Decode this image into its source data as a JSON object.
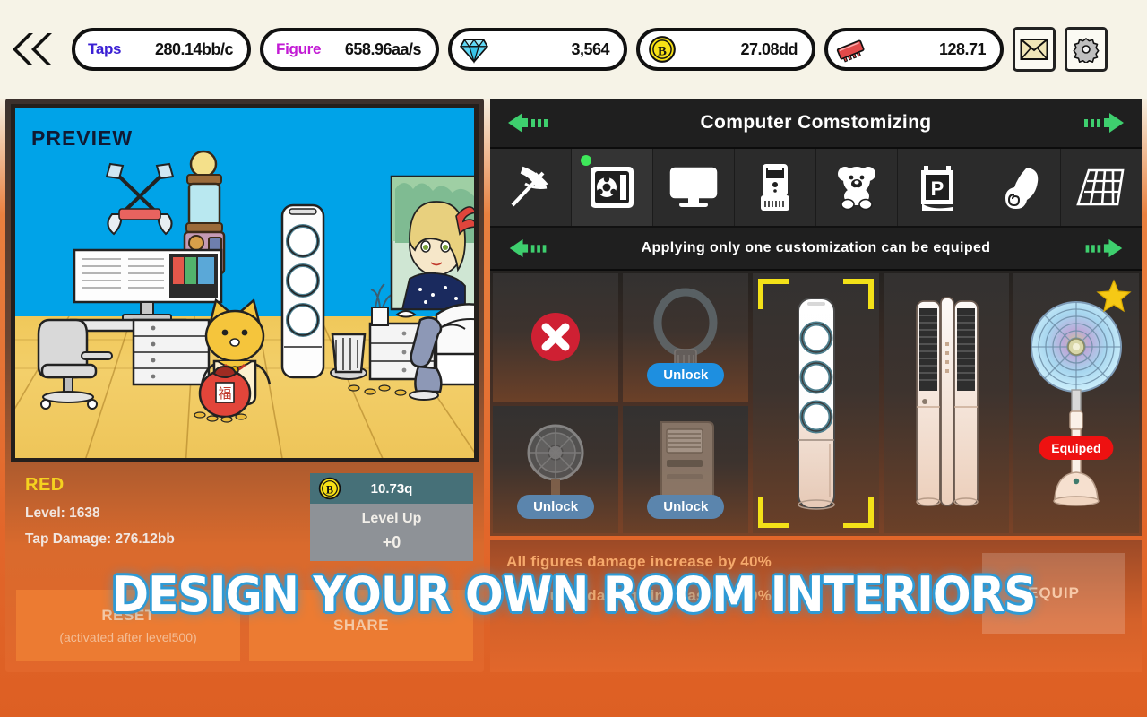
{
  "topbar": {
    "back_icon": "double-chevron-left-icon",
    "stats": [
      {
        "icon": "none",
        "label": "Taps",
        "value": "280.14bb/c",
        "label_color": "#3b20d4"
      },
      {
        "icon": "none",
        "label": "Figure",
        "value": "658.96aa/s",
        "label_color": "#c21ad4"
      }
    ],
    "currencies": [
      {
        "icon": "gem-icon",
        "value": "3,564"
      },
      {
        "icon": "bitcoin-icon",
        "value": "27.08dd"
      },
      {
        "icon": "ram-chip-icon",
        "value": "128.71"
      }
    ],
    "buttons": [
      {
        "icon": "mail-icon",
        "name": "mail-button"
      },
      {
        "icon": "gear-icon",
        "name": "settings-button"
      }
    ]
  },
  "left": {
    "preview_label": "PREVIEW",
    "character_name": "RED",
    "level": "Level: 1638",
    "tap_damage": "Tap Damage: 276.12bb",
    "levelup": {
      "icon": "bitcoin-icon",
      "cost": "10.73q",
      "title": "Level Up",
      "amount": "+0"
    },
    "buttons": [
      {
        "title": "RESET",
        "sub": "(activated after level500)",
        "name": "reset-button"
      },
      {
        "title": "SHARE",
        "sub": "",
        "name": "share-button"
      }
    ]
  },
  "right": {
    "header": {
      "title": "Computer Comstomizing",
      "prev_icon": "arrow-left-icon",
      "next_icon": "arrow-right-icon"
    },
    "categories": [
      {
        "icon": "pickaxe-icon",
        "name": "category-pickaxe",
        "selected": false
      },
      {
        "icon": "pc-case-icon",
        "name": "category-pc-case",
        "selected": true
      },
      {
        "icon": "monitor-icon",
        "name": "category-monitor",
        "selected": false
      },
      {
        "icon": "air-cooler-icon",
        "name": "category-air-cooler",
        "selected": false
      },
      {
        "icon": "teddy-bear-icon",
        "name": "category-teddy-bear",
        "selected": false
      },
      {
        "icon": "poster-icon",
        "name": "category-poster",
        "selected": false
      },
      {
        "icon": "wallpaper-icon",
        "name": "category-wallpaper",
        "selected": false
      },
      {
        "icon": "flooring-icon",
        "name": "category-flooring",
        "selected": false
      }
    ],
    "subheader": {
      "title": "Applying only one customization can be equiped",
      "prev_icon": "arrow-left-icon",
      "next_icon": "arrow-right-icon"
    },
    "items": [
      {
        "name": "item-none",
        "icon": "red-x-icon",
        "badge": "",
        "state": "none"
      },
      {
        "name": "item-bladeless-fan",
        "icon": "bladeless-fan-icon",
        "badge": "Unlock",
        "state": "locked"
      },
      {
        "name": "item-desk-fan",
        "icon": "desk-fan-icon",
        "badge": "Unlock",
        "state": "locked"
      },
      {
        "name": "item-portable-ac",
        "icon": "portable-ac-icon",
        "badge": "Unlock",
        "state": "locked"
      },
      {
        "name": "item-tower-ac",
        "icon": "tower-ac-icon",
        "badge": "",
        "state": "selected"
      },
      {
        "name": "item-dual-tower-ac",
        "icon": "dual-tower-ac-icon",
        "badge": "",
        "state": "owned"
      },
      {
        "name": "item-stand-fan",
        "icon": "stand-fan-icon",
        "badge": "Equiped",
        "state": "equiped"
      }
    ],
    "info": {
      "line1": "All figures damage increase by 40%",
      "line2": "All figures damage increase by 40%",
      "equip_label": "EQUIP"
    }
  },
  "banner": {
    "text": "DESIGN YOUR OWN ROOM INTERIORS"
  },
  "colors": {
    "accent_orange": "#e2672b",
    "cream": "#f6f3e7",
    "select_yellow": "#f3e118",
    "unlock_blue": "#1e8fe0",
    "equiped_red": "#ee1111",
    "green_arrow": "#3ecf6e",
    "banner_outline": "#2f9bd6"
  }
}
